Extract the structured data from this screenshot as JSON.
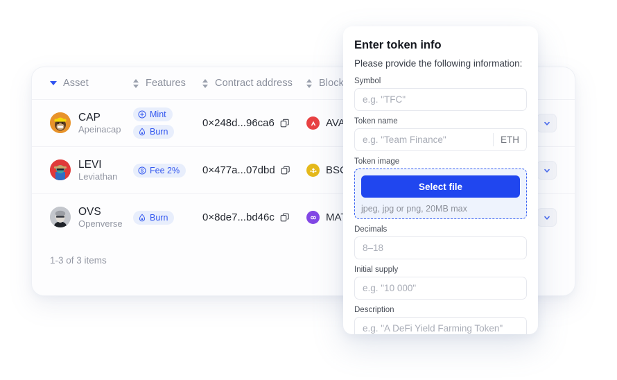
{
  "table": {
    "columns": [
      {
        "label": "Asset",
        "sort": "desc"
      },
      {
        "label": "Features",
        "sort": "both"
      },
      {
        "label": "Contract address",
        "sort": "both"
      },
      {
        "label": "Blockchain",
        "sort": "both"
      }
    ],
    "rows": [
      {
        "symbol": "CAP",
        "name": "Apeinacap",
        "avatar_color": "#e8932a",
        "features": [
          {
            "label": "Mint",
            "icon": "plus-circle-icon"
          },
          {
            "label": "Burn",
            "icon": "flame-icon"
          }
        ],
        "contract": "0×248d...96ca6",
        "chain": "AVAX",
        "chain_color": "#e84142",
        "chain_glyph": "▲"
      },
      {
        "symbol": "LEVI",
        "name": "Leviathan",
        "avatar_color": "#e03a3a",
        "features": [
          {
            "label": "Fee 2%",
            "icon": "dollar-circle-icon"
          }
        ],
        "contract": "0×477a...07dbd",
        "chain": "BSC",
        "chain_color": "#e5b91b",
        "chain_glyph": "◈"
      },
      {
        "symbol": "OVS",
        "name": "Openverse",
        "avatar_color": "#9a9a9a",
        "features": [
          {
            "label": "Burn",
            "icon": "flame-icon"
          }
        ],
        "contract": "0×8de7...bd46c",
        "chain": "MATIC",
        "chain_color": "#8247e5",
        "chain_glyph": "⬡"
      }
    ],
    "footer": "1-3 of 3 items"
  },
  "modal": {
    "title": "Enter token info",
    "subtitle": "Please provide the following information:",
    "fields": {
      "symbol": {
        "label": "Symbol",
        "placeholder": "e.g. \"TFC\"",
        "value": ""
      },
      "token_name": {
        "label": "Token name",
        "placeholder": "e.g. \"Team Finance\"",
        "value": "",
        "suffix": "ETH"
      },
      "token_image": {
        "label": "Token image",
        "button": "Select file",
        "hint": "jpeg, jpg or png, 20MB max"
      },
      "decimals": {
        "label": "Decimals",
        "placeholder": "8–18",
        "value": ""
      },
      "initial_supply": {
        "label": "Initial supply",
        "placeholder": "e.g. \"10 000\"",
        "value": ""
      },
      "description": {
        "label": "Description",
        "placeholder": "e.g. \"A DeFi Yield Farming Token\"",
        "value": ""
      }
    }
  },
  "colors": {
    "accent": "#2046ef",
    "badge_bg": "#e8eefc",
    "badge_text": "#3257ef"
  }
}
